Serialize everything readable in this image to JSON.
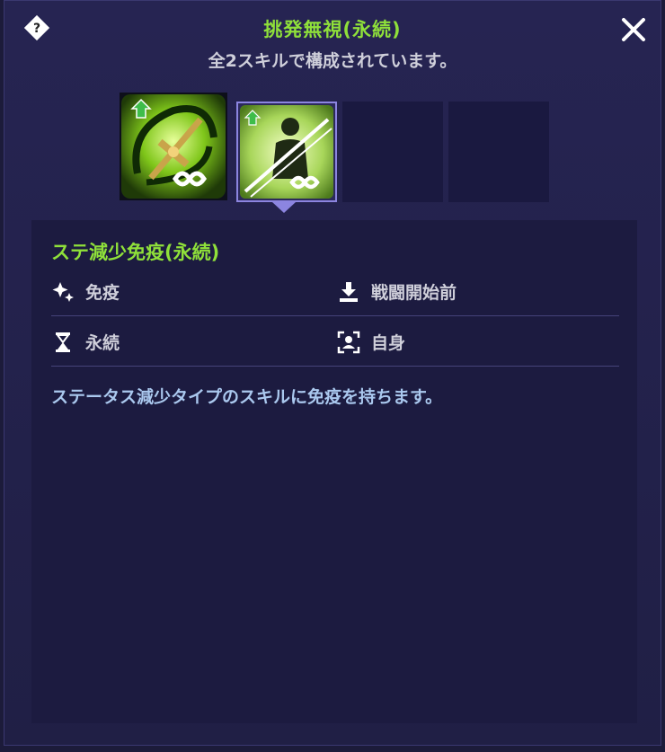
{
  "header": {
    "title": "挑発無視(永続)",
    "subtitle": "全2スキルで構成されています。"
  },
  "skills": {
    "slots": [
      {
        "name": "skill-icon-provoke-immunity",
        "state": "filled"
      },
      {
        "name": "skill-icon-debuff-immunity",
        "state": "selected"
      },
      {
        "name": "empty-slot",
        "state": "empty"
      },
      {
        "name": "empty-slot",
        "state": "empty"
      }
    ]
  },
  "detail": {
    "name": "ステ減少免疫(永続)",
    "type": "免疫",
    "timing": "戦闘開始前",
    "duration": "永続",
    "target": "自身",
    "description": "ステータス減少タイプのスキルに免疫を持ちます。"
  },
  "colors": {
    "accent_green": "#8fe03a",
    "panel_bg": "#1c1b40",
    "desc_blue": "#aac8ee",
    "selected_border": "#8c85e0"
  }
}
